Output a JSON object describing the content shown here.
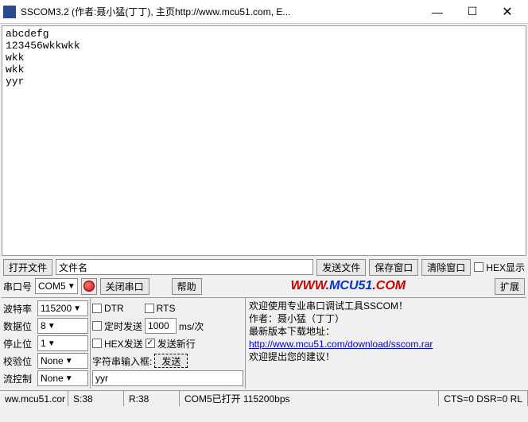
{
  "window": {
    "title": "SSCOM3.2 (作者:聂小猛(丁丁), 主页http://www.mcu51.com, E..."
  },
  "terminal_text": "abcdefg\n123456wkkwkk\nwkk\nwkk\nyyr",
  "filebar": {
    "open_file": "打开文件",
    "filename": "文件名",
    "send_file": "发送文件",
    "save_window": "保存窗口",
    "clear_window": "清除窗口",
    "hex_display": "HEX显示"
  },
  "portbar": {
    "port_label": "串口号",
    "port_value": "COM5",
    "close_port": "关闭串口",
    "help": "帮助",
    "expand": "扩展",
    "url_www": "WWW.",
    "url_mcu": "MCU51",
    "url_com": ".COM"
  },
  "config": {
    "baud_label": "波特率",
    "baud_value": "115200",
    "databits_label": "数据位",
    "databits_value": "8",
    "stopbits_label": "停止位",
    "stopbits_value": "1",
    "parity_label": "校验位",
    "parity_value": "None",
    "flow_label": "流控制",
    "flow_value": "None"
  },
  "options": {
    "dtr": "DTR",
    "rts": "RTS",
    "timed_send": "定时发送",
    "interval_value": "1000",
    "interval_unit": "ms/次",
    "hex_send": "HEX发送",
    "send_newline": "发送新行",
    "input_label": "字符串输入框:",
    "send_btn": "发送",
    "input_value": "yyr"
  },
  "info": {
    "line1": "欢迎使用专业串口调试工具SSCOM！",
    "line2": "作者：聂小猛（丁丁）",
    "line3": "最新版本下载地址：",
    "link": "http://www.mcu51.com/download/sscom.rar",
    "line4": "欢迎提出您的建议！"
  },
  "status": {
    "url": "ww.mcu51.cor",
    "s": "S:38",
    "r": "R:38",
    "port": "COM5已打开 115200bps",
    "cts": "CTS=0 DSR=0 RL"
  }
}
